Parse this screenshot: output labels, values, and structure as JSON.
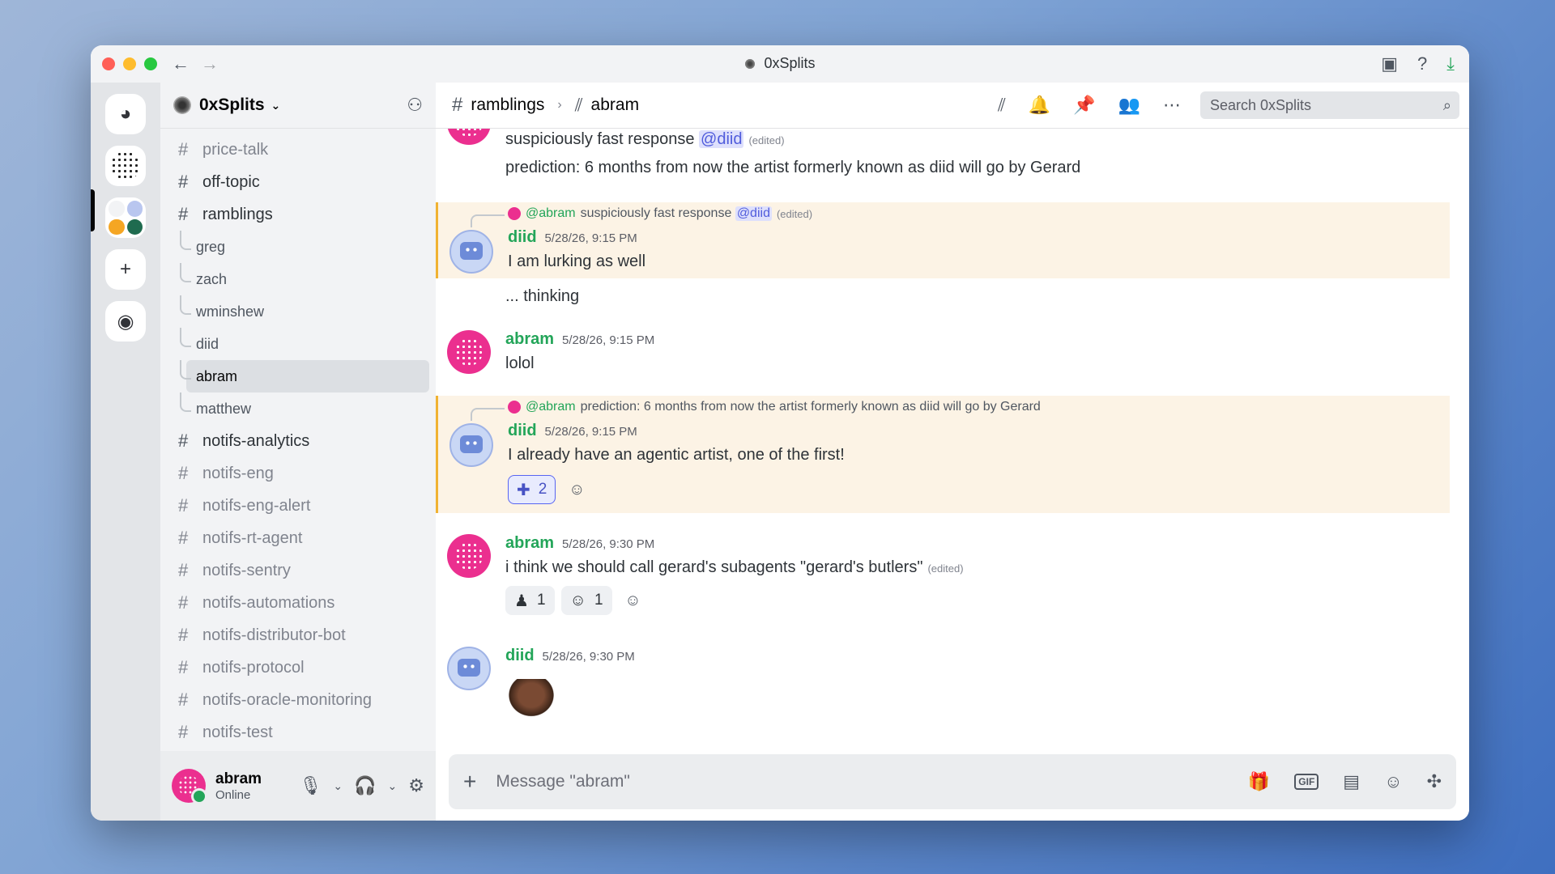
{
  "window": {
    "title": "0xSplits",
    "nav_back": "←",
    "nav_forward": "→"
  },
  "titlebar_icons": {
    "inbox": "▣",
    "help": "?",
    "download": "⤓"
  },
  "server": {
    "name": "0xSplits",
    "caret": "⌄",
    "invite_icon": "⚇"
  },
  "rail": {
    "home_icon": "◕",
    "add_icon": "+",
    "discover_icon": "◉"
  },
  "channels": [
    {
      "name": "price-talk",
      "bright": false
    },
    {
      "name": "off-topic",
      "bright": true
    },
    {
      "name": "ramblings",
      "bright": true
    }
  ],
  "threads": [
    "greg",
    "zach",
    "wminshew",
    "diid",
    "abram",
    "matthew"
  ],
  "active_thread": "abram",
  "channels_after": [
    {
      "name": "notifs-analytics",
      "bright": true
    },
    {
      "name": "notifs-eng",
      "bright": false
    },
    {
      "name": "notifs-eng-alert",
      "bright": false
    },
    {
      "name": "notifs-rt-agent",
      "bright": false
    },
    {
      "name": "notifs-sentry",
      "bright": false
    },
    {
      "name": "notifs-automations",
      "bright": false
    },
    {
      "name": "notifs-distributor-bot",
      "bright": false
    },
    {
      "name": "notifs-protocol",
      "bright": false
    },
    {
      "name": "notifs-oracle-monitoring",
      "bright": false
    },
    {
      "name": "notifs-test",
      "bright": false
    }
  ],
  "user_panel": {
    "name": "abram",
    "status": "Online"
  },
  "header": {
    "hash": "#",
    "channel": "ramblings",
    "separator": "›",
    "thread": "abram",
    "search_placeholder": "Search 0xSplits"
  },
  "messages": {
    "top": {
      "line1": "suspiciously fast response",
      "line1_mention": "@diid",
      "line1_edited": "(edited)",
      "line2": "prediction: 6 months from now the artist formerly known as diid will go by Gerard"
    },
    "m1": {
      "reply_to": "@abram",
      "reply_text": "suspiciously fast response",
      "reply_mention": "@diid",
      "reply_edited": "(edited)",
      "author": "diid",
      "timestamp": "5/28/26, 9:15 PM",
      "text": "I am lurking as well",
      "text2": "... thinking"
    },
    "m2": {
      "author": "abram",
      "timestamp": "5/28/26, 9:15 PM",
      "text": "lolol"
    },
    "m3": {
      "reply_to": "@abram",
      "reply_text": "prediction: 6 months from now the artist formerly known as diid will go by Gerard",
      "author": "diid",
      "timestamp": "5/28/26, 9:15 PM",
      "text": "I already have an agentic artist, one of the first!",
      "reaction_emoji": "✚",
      "reaction_count": "2"
    },
    "m4": {
      "author": "abram",
      "timestamp": "5/28/26, 9:30 PM",
      "text": "i think we should call gerard's subagents \"gerard's butlers\"",
      "edited": "(edited)",
      "reactions": [
        {
          "emoji": "♟",
          "count": "1"
        },
        {
          "emoji": "☺",
          "count": "1"
        }
      ]
    },
    "m5": {
      "author": "diid",
      "timestamp": "5/28/26, 9:30 PM"
    }
  },
  "composer": {
    "placeholder": "Message \"abram\"",
    "gif_label": "GIF"
  },
  "colors": {
    "accent": "#5865f2",
    "author_green": "#23a559",
    "highlight_bg": "#fcf3e5",
    "highlight_border": "#f0b232",
    "avatar_pink": "#eb2f8f"
  }
}
